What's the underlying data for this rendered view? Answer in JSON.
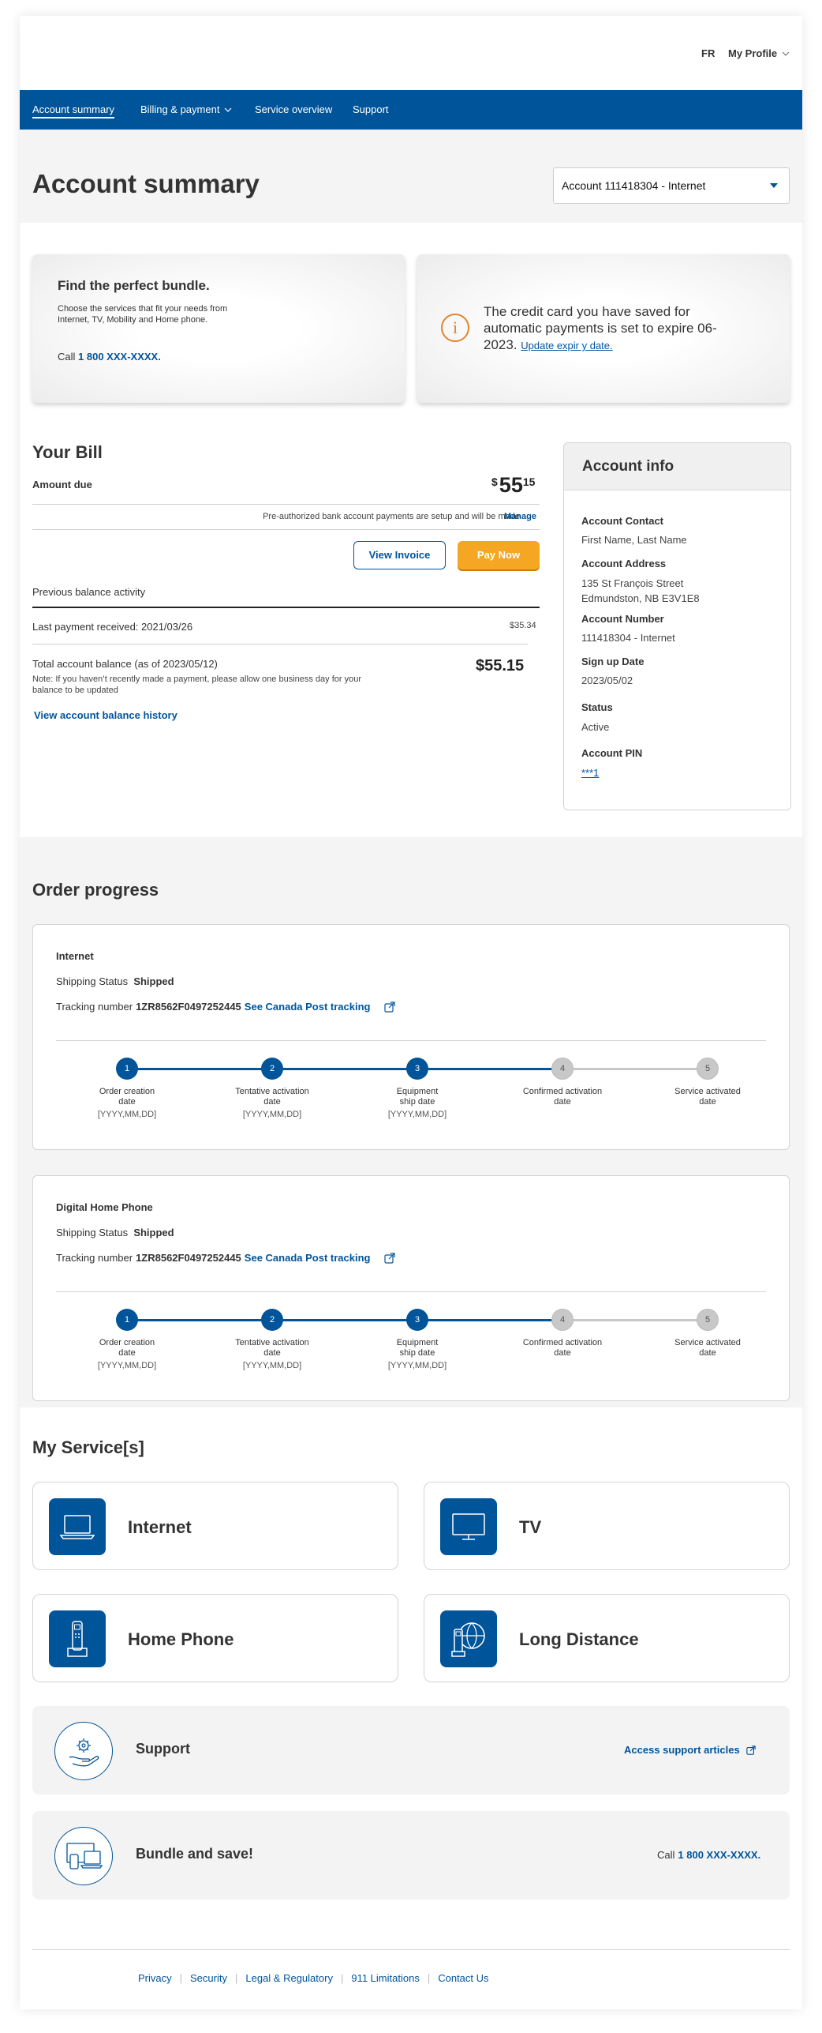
{
  "header": {
    "lang": "FR",
    "profile": "My Profile"
  },
  "nav": {
    "items": [
      {
        "label": "Account summary"
      },
      {
        "label": "Billing & payment"
      },
      {
        "label": "Service overview"
      },
      {
        "label": "Support"
      }
    ]
  },
  "page": {
    "title": "Account summary",
    "account_select": "Account 111418304 - Internet"
  },
  "promo": {
    "title": "Find the perfect bundle.",
    "text": "Choose the services that fit your needs from Internet, TV, Mobility and Home phone.",
    "call_prefix": "Call",
    "phone": "1 800 XXX-XXXX."
  },
  "notice": {
    "icon": "info-icon",
    "text": "The credit card you have saved for automatic payments is set to expire 06-2023.",
    "link": "Update expir y date."
  },
  "bill": {
    "title": "Your Bill",
    "amount_label": "Amount due",
    "currency": "$",
    "amount_dollars": "55",
    "amount_cents": "15",
    "preauth_text": "Pre-authorized bank account payments are setup and will be made",
    "manage": "Manage",
    "view_invoice": "View Invoice",
    "pay_now": "Pay Now",
    "previous_activity": "Previous balance activity",
    "last_payment": "Last payment received: 2021/03/26",
    "last_payment_amount": "$35.34",
    "total_label": "Total account balance (as of 2023/05/12)",
    "total_note": "Note: If you haven’t recently made a payment, please allow one business day for your balance to be updated",
    "total_amount": "$55.15",
    "history_link": "View account balance history"
  },
  "account_info": {
    "title": "Account info",
    "contact_label": "Account Contact",
    "contact_value": "First Name, Last Name",
    "address_label": "Account Address",
    "address_line1": "135 St François Street",
    "address_line2": "Edmundston, NB E3V1E8",
    "number_label": "Account Number",
    "number_value": "111418304 - Internet",
    "signup_label": "Sign up Date",
    "signup_value": "2023/05/02",
    "status_label": "Status",
    "status_value": "Active",
    "pin_label": "Account PIN",
    "pin_value": "***1"
  },
  "orders": {
    "title": "Order progress",
    "status_label": "Shipping Status",
    "tracking_label": "Tracking number",
    "tracking_link": "See Canada Post tracking",
    "cards": [
      {
        "name": "Internet",
        "status": "Shipped",
        "tracking_number": "1ZR8562F0497252445",
        "completed_steps": 3
      },
      {
        "name": "Digital Home Phone",
        "status": "Shipped",
        "tracking_number": "1ZR8562F0497252445",
        "completed_steps": 3
      }
    ],
    "steps": [
      {
        "num": "1",
        "line1": "Order creation",
        "line2": "date",
        "date": "[YYYY,MM,DD]"
      },
      {
        "num": "2",
        "line1": "Tentative activation",
        "line2": "date",
        "date": "[YYYY,MM,DD]"
      },
      {
        "num": "3",
        "line1": "Equipment",
        "line2": "ship date",
        "date": "[YYYY,MM,DD]"
      },
      {
        "num": "4",
        "line1": "Confirmed activation",
        "line2": "date",
        "date": ""
      },
      {
        "num": "5",
        "line1": "Service activated",
        "line2": "date",
        "date": ""
      }
    ]
  },
  "services": {
    "title": "My Service[s]",
    "items": [
      {
        "label": "Internet",
        "icon": "laptop-icon"
      },
      {
        "label": "TV",
        "icon": "monitor-icon"
      },
      {
        "label": "Home Phone",
        "icon": "home-phone-icon"
      },
      {
        "label": "Long Distance",
        "icon": "globe-phone-icon"
      }
    ]
  },
  "support": {
    "label": "Support",
    "icon": "hand-gear-icon",
    "link": "Access support articles"
  },
  "bundle": {
    "label": "Bundle and save!",
    "icon": "devices-icon",
    "call_prefix": "Call",
    "phone": "1 800 XXX-XXXX."
  },
  "footer": {
    "links": [
      "Privacy",
      "Security",
      "Legal & Regulatory",
      "911 Limitations",
      "Contact Us"
    ]
  },
  "colors": {
    "brand_blue": "#00549a",
    "accent_orange": "#f5a623",
    "step_inactive": "#c8c8c8"
  }
}
